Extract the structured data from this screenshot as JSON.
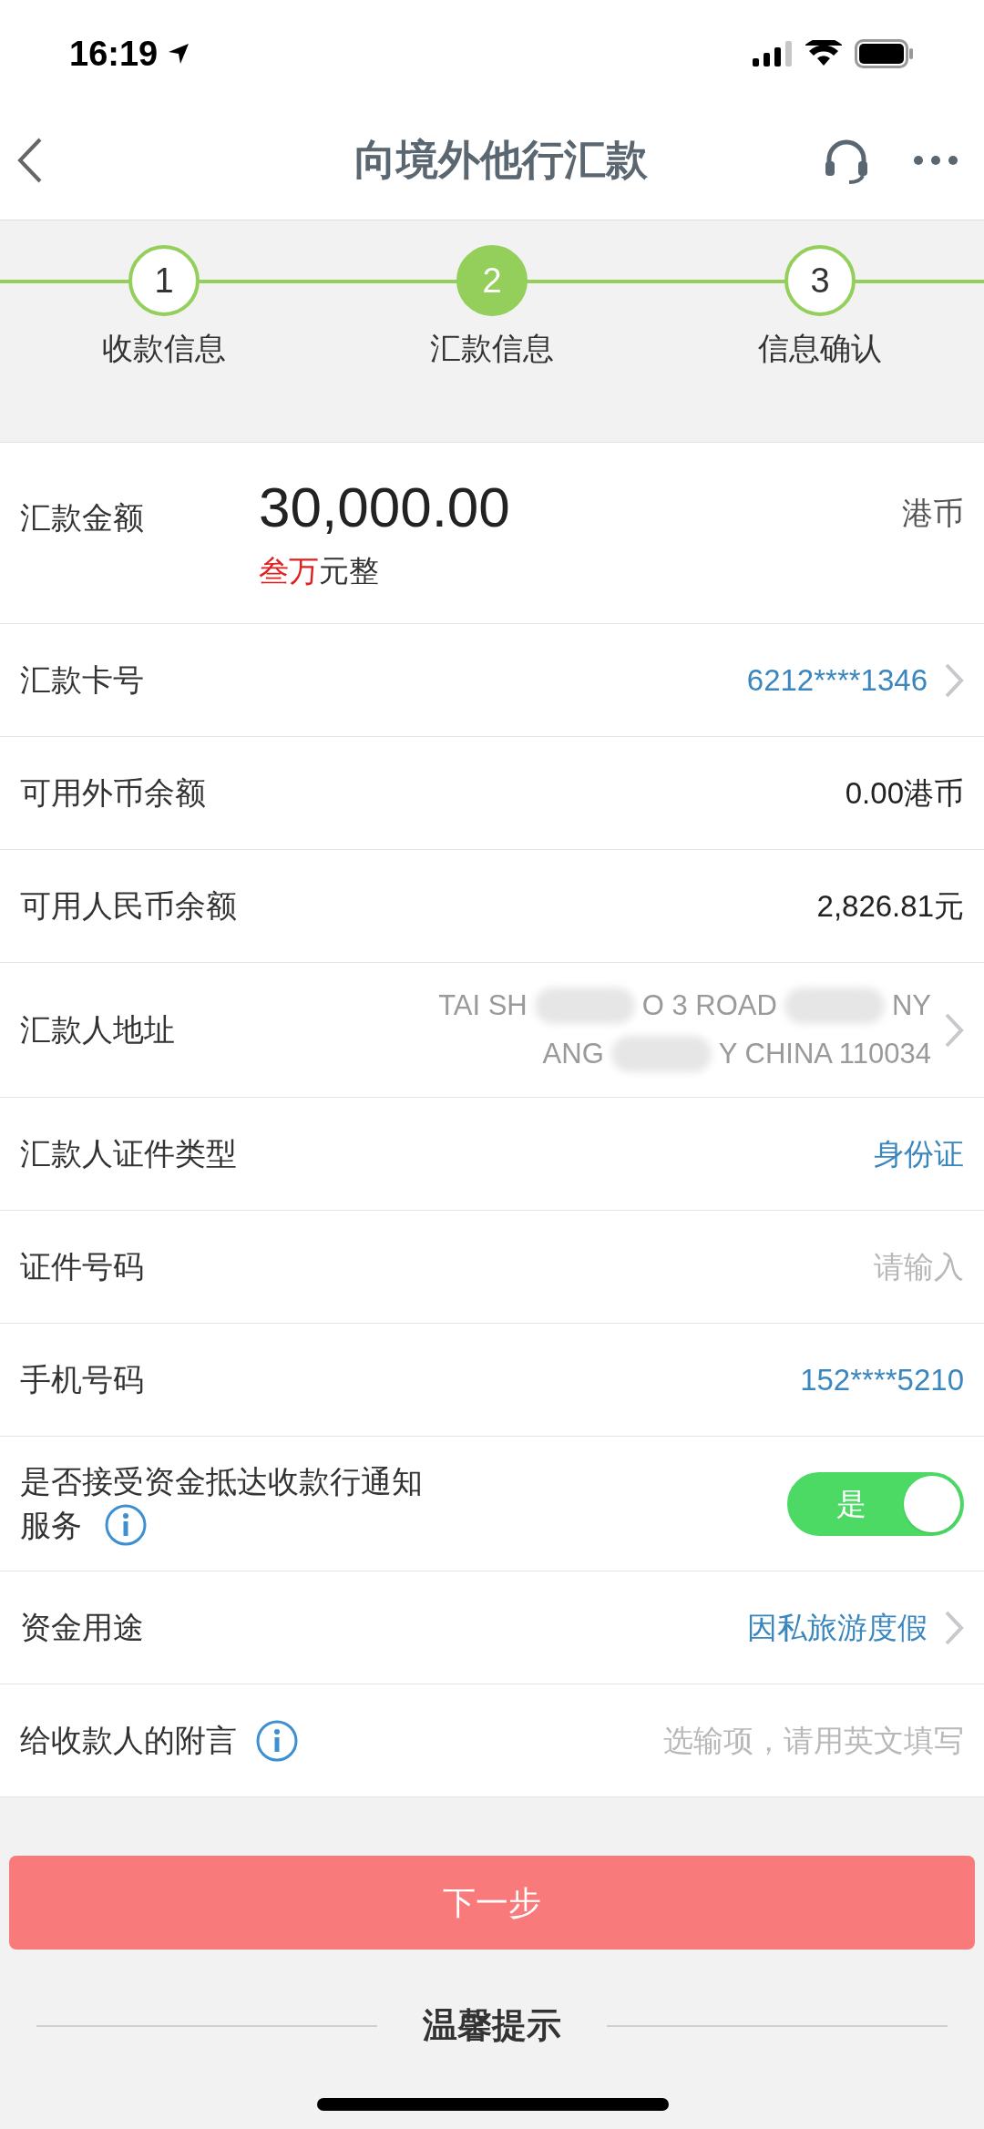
{
  "status_bar": {
    "time": "16:19"
  },
  "nav": {
    "title": "向境外他行汇款"
  },
  "steps": [
    {
      "number": "1",
      "label": "收款信息",
      "selected": false
    },
    {
      "number": "2",
      "label": "汇款信息",
      "selected": true
    },
    {
      "number": "3",
      "label": "信息确认",
      "selected": false
    }
  ],
  "amount": {
    "label": "汇款金额",
    "value": "30,000.00",
    "currency": "港币",
    "words_highlight": "叁万",
    "words_rest": "元整"
  },
  "rows": [
    {
      "kind": "link",
      "label": "汇款卡号",
      "value": "6212****1346"
    },
    {
      "kind": "text",
      "label": "可用外币余额",
      "value": "0.00港币"
    },
    {
      "kind": "text",
      "label": "可用人民币余额",
      "value": "2,826.81元"
    },
    {
      "kind": "address",
      "label": "汇款人地址",
      "lines": [
        [
          "TAI SH",
          "O 3 ROAD",
          "NY"
        ],
        [
          "ANG",
          "Y CHINA 110034"
        ]
      ]
    },
    {
      "kind": "select",
      "label": "汇款人证件类型",
      "value": "身份证"
    },
    {
      "kind": "input",
      "label": "证件号码",
      "placeholder": "请输入"
    },
    {
      "kind": "select",
      "label": "手机号码",
      "value": "152****5210"
    },
    {
      "kind": "toggle",
      "label_lines": [
        "是否接受资金抵达收款行通知",
        "服务"
      ],
      "on": true,
      "toggle_label": "是"
    },
    {
      "kind": "link",
      "label": "资金用途",
      "value": "因私旅游度假"
    },
    {
      "kind": "note",
      "label": "给收款人的附言",
      "placeholder": "选输项，请用英文填写"
    }
  ],
  "button": "下一步",
  "tips_title": "温馨提示"
}
